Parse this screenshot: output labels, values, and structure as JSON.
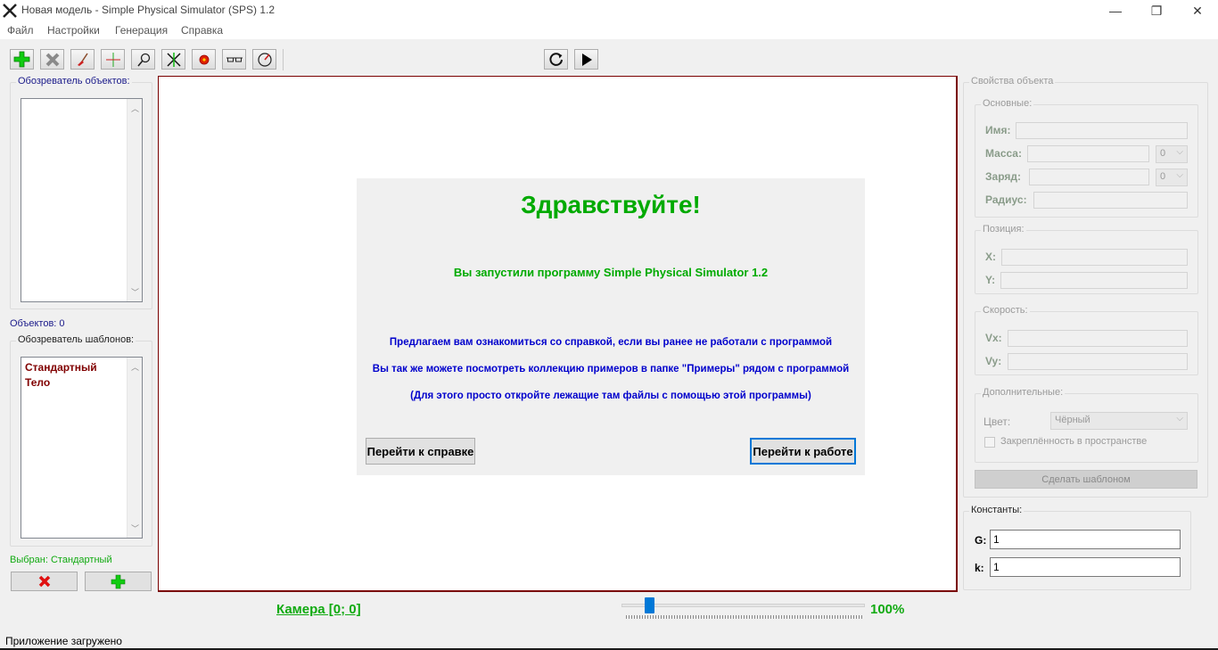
{
  "window": {
    "title": "Новая модель - Simple Physical Simulator (SPS) 1.2",
    "minimize_glyph": "—",
    "maximize_glyph": "❐",
    "close_glyph": "✕"
  },
  "menu": {
    "items": [
      "Файл",
      "Настройки",
      "Генерация",
      "Справка"
    ]
  },
  "toolbar": {
    "tools": [
      "add-icon",
      "delete-icon",
      "broom-icon",
      "crosshair-icon",
      "magnifier-icon",
      "cross-lines-icon",
      "red-dot-icon",
      "glasses-icon",
      "compass-icon"
    ],
    "playback": [
      "reset-icon",
      "play-icon"
    ]
  },
  "left": {
    "object_browser_title": "Обозреватель объектов:",
    "objects_count": "Объектов: 0",
    "template_browser_title": "Обозреватель шаблонов:",
    "templates": [
      "Стандартный",
      "Тело"
    ],
    "selected": "Выбран: Стандартный"
  },
  "welcome": {
    "heading": "Здравствуйте!",
    "launched": "Вы запустили программу Simple Physical Simulator 1.2",
    "line1": "Предлагаем вам ознакомиться со справкой, если вы ранее не работали с программой",
    "line2": "Вы так же можете посмотреть коллекцию примеров в папке \"Примеры\" рядом с программой",
    "line3": "(Для этого просто откройте лежащие там файлы с помощью этой программы)",
    "help_button": "Перейти к справке",
    "work_button": "Перейти к работе"
  },
  "properties": {
    "title": "Свойства объекта",
    "basic_title": "Основные:",
    "name_label": "Имя:",
    "mass_label": "Масса:",
    "mass_unit": "0",
    "charge_label": "Заряд:",
    "charge_unit": "0",
    "radius_label": "Радиус:",
    "position_title": "Позиция:",
    "x_label": "X:",
    "y_label": "Y:",
    "speed_title": "Скорость:",
    "vx_label": "Vx:",
    "vy_label": "Vy:",
    "extra_title": "Дополнительные:",
    "color_label": "Цвет:",
    "color_value": "Чёрный",
    "pinned_label": "Закреплённость в пространстве",
    "make_template_button": "Сделать шаблоном"
  },
  "constants": {
    "title": "Константы:",
    "g_label": "G:",
    "g_value": "1",
    "k_label": "k:",
    "k_value": "1"
  },
  "bottom": {
    "camera": "Камера [0; 0]",
    "zoom": "100%",
    "zoom_slider_value": 0.1,
    "status": "Приложение загружено"
  },
  "colors": {
    "green": "#00aa00",
    "blue": "#0000cc",
    "dark_red": "#800000",
    "canvas_border": "#7a0000",
    "accent": "#0078d7"
  }
}
